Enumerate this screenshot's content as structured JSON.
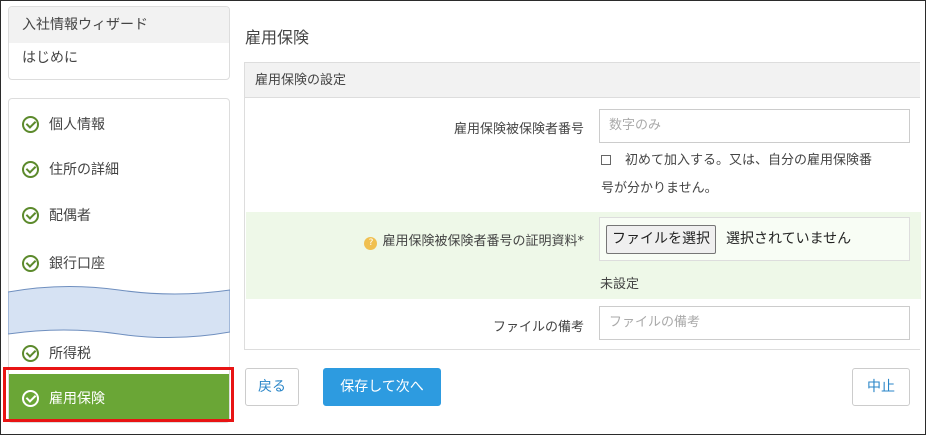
{
  "sidebar": {
    "wizard_title": "入社情報ウィザード",
    "intro": "はじめに",
    "steps": [
      {
        "label": "個人情報"
      },
      {
        "label": "住所の詳細"
      },
      {
        "label": "配偶者"
      },
      {
        "label": "銀行口座"
      },
      {
        "label": "所得税"
      },
      {
        "label": "雇用保険"
      }
    ],
    "active_step": "雇用保険"
  },
  "main": {
    "page_title": "雇用保険",
    "panel_title": "雇用保険の設定",
    "insured_number": {
      "label": "雇用保険被保険者番号",
      "placeholder": "数字のみ",
      "checkbox_text_line1": "初めて加入する。又は、自分の雇用保険番",
      "checkbox_text_line2": "号が分かりません。"
    },
    "proof_document": {
      "label": "雇用保険被保険者番号の証明資料*",
      "file_button": "ファイルを選択",
      "file_status": "選択されていません",
      "status": "未設定"
    },
    "file_note": {
      "label": "ファイルの備考",
      "placeholder": "ファイルの備考"
    }
  },
  "buttons": {
    "back": "戻る",
    "save_next": "保存して次へ",
    "cancel": "中止"
  },
  "colors": {
    "active_step": "#6aa636",
    "primary": "#2d9be0",
    "highlight": "#e81414"
  }
}
